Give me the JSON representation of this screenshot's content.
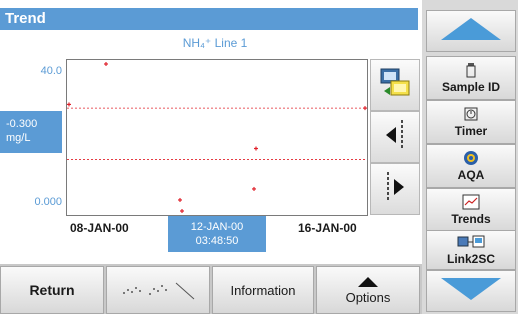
{
  "title": "Trend",
  "chart_title": "NH₄⁺ Line 1",
  "y_axis": {
    "max_label": "40.0",
    "min_label": "0.000"
  },
  "cursor": {
    "value": "-0.300",
    "unit": "mg/L"
  },
  "x_axis": {
    "left_label": "08-JAN-00",
    "right_label": "16-JAN-00",
    "selected_date": "12-JAN-00",
    "selected_time": "03:48:50"
  },
  "bottom": {
    "return": "Return",
    "information": "Information",
    "options": "Options"
  },
  "menu": {
    "sample_id": "Sample ID",
    "timer": "Timer",
    "aqa": "AQA",
    "trends": "Trends",
    "link2sc": "Link2SC"
  },
  "icons": [
    "arrow-up-icon",
    "arrow-down-icon",
    "transfer-icon",
    "scroll-left-icon",
    "scroll-right-icon",
    "plot-mode-icon",
    "options-up-icon",
    "sample-id-icon",
    "timer-icon",
    "aqa-icon",
    "trends-icon",
    "link2sc-icon"
  ],
  "colors": {
    "accent": "#5b9bd5",
    "point": "#e0202a"
  },
  "chart_data": {
    "type": "scatter",
    "series": [
      {
        "values": [
          {
            "x": "08-JAN-00",
            "y": 29
          },
          {
            "x": "09-JAN-00",
            "y": 40
          },
          {
            "x": "11-JAN-00",
            "y": 3
          },
          {
            "x": "11-JAN-00",
            "y": 0
          },
          {
            "x": "13-JAN-00",
            "y": 6
          },
          {
            "x": "13-JAN-00",
            "y": 17
          },
          {
            "x": "16-JAN-00",
            "y": 28
          }
        ]
      }
    ],
    "ylim": [
      0,
      40
    ],
    "reference_lines": [
      28,
      14
    ],
    "grid": false
  }
}
